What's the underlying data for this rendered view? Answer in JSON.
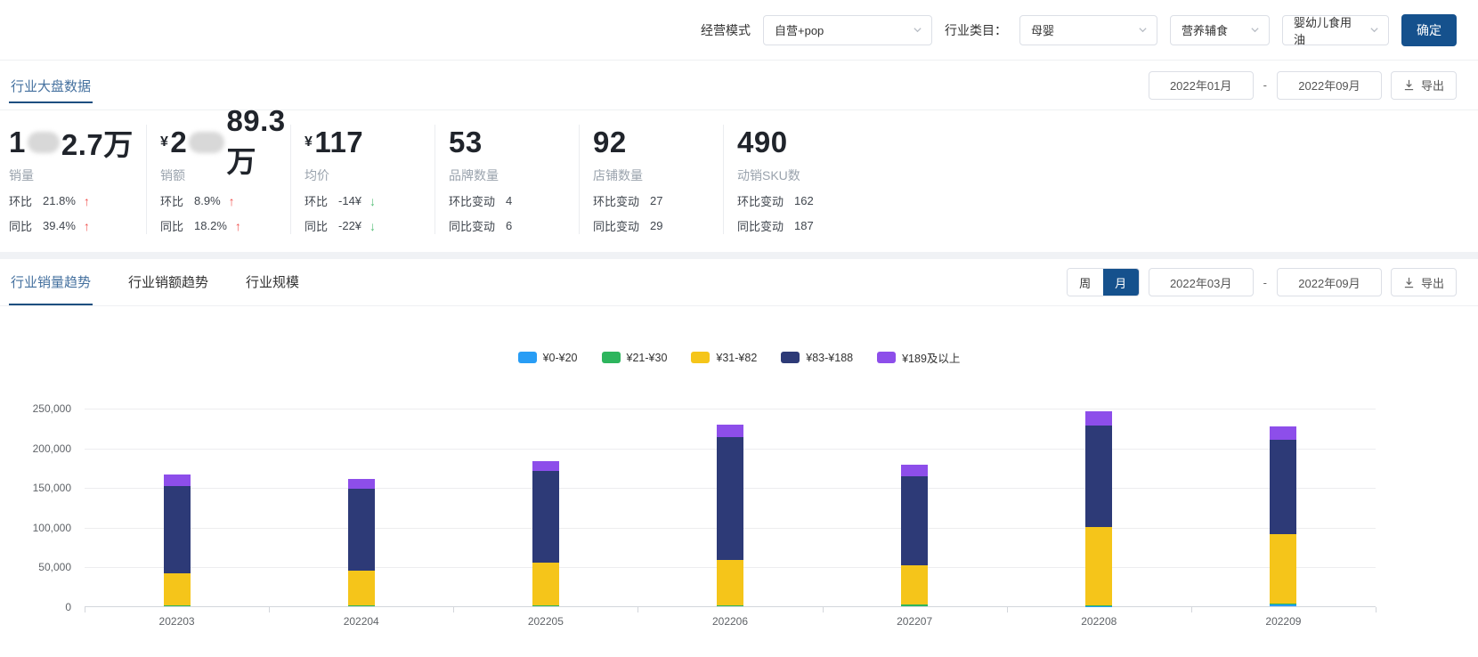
{
  "filter_bar": {
    "mode_label": "经营模式",
    "mode_value": "自营+pop",
    "category_label": "行业类目：",
    "category_value": "母婴",
    "subcategory_value": "营养辅食",
    "leaf_category_value": "婴幼儿食用油",
    "confirm_label": "确定"
  },
  "overview": {
    "title": "行业大盘数据",
    "date_start": "2022年01月",
    "date_sep": "-",
    "date_end": "2022年09月",
    "export_label": "导出",
    "cards": [
      {
        "big": {
          "prefix": "1",
          "masked": true,
          "suffix": "2.7万"
        },
        "label": "销量",
        "rows": [
          {
            "k": "环比",
            "v": "21.8%",
            "arrow": "↑"
          },
          {
            "k": "同比",
            "v": "39.4%",
            "arrow": "↑"
          }
        ]
      },
      {
        "big": {
          "currency": "¥",
          "prefix": "2",
          "masked": true,
          "suffix": "89.3万"
        },
        "label": "销额",
        "rows": [
          {
            "k": "环比",
            "v": "8.9%",
            "arrow": "↑"
          },
          {
            "k": "同比",
            "v": "18.2%",
            "arrow": "↑"
          }
        ]
      },
      {
        "big": {
          "currency": "¥",
          "prefix": "117"
        },
        "label": "均价",
        "rows": [
          {
            "k": "环比",
            "v": "-14¥",
            "arrow": "↓"
          },
          {
            "k": "同比",
            "v": "-22¥",
            "arrow": "↓"
          }
        ]
      },
      {
        "big": {
          "prefix": "53"
        },
        "label": "品牌数量",
        "rows": [
          {
            "k": "环比变动",
            "v": "4"
          },
          {
            "k": "同比变动",
            "v": "6"
          }
        ]
      },
      {
        "big": {
          "prefix": "92"
        },
        "label": "店铺数量",
        "rows": [
          {
            "k": "环比变动",
            "v": "27"
          },
          {
            "k": "同比变动",
            "v": "29"
          }
        ]
      },
      {
        "big": {
          "prefix": "490"
        },
        "label": "动销SKU数",
        "rows": [
          {
            "k": "环比变动",
            "v": "162"
          },
          {
            "k": "同比变动",
            "v": "187"
          }
        ]
      }
    ]
  },
  "trend": {
    "tabs": [
      {
        "label": "行业销量趋势",
        "active": true
      },
      {
        "label": "行业销额趋势",
        "active": false
      },
      {
        "label": "行业规模",
        "active": false
      }
    ],
    "period_week": "周",
    "period_month": "月",
    "period_active": "月",
    "date_start": "2022年03月",
    "date_sep": "-",
    "date_end": "2022年09月",
    "export_label": "导出"
  },
  "chart_data": {
    "type": "bar",
    "stacked": true,
    "categories": [
      "202203",
      "202204",
      "202205",
      "202206",
      "202207",
      "202208",
      "202209"
    ],
    "series": [
      {
        "name": "¥0-¥20",
        "color": "#289df5",
        "values": [
          0,
          0,
          0,
          0,
          0,
          500,
          2000
        ]
      },
      {
        "name": "¥21-¥30",
        "color": "#2db55d",
        "values": [
          1500,
          1000,
          1000,
          1000,
          2000,
          1000,
          1000
        ]
      },
      {
        "name": "¥31-¥82",
        "color": "#f5c51a",
        "values": [
          40000,
          44000,
          54000,
          57000,
          50000,
          98000,
          88000
        ]
      },
      {
        "name": "¥83-¥188",
        "color": "#2d3a77",
        "values": [
          110000,
          103000,
          115000,
          155000,
          112000,
          128000,
          119000
        ]
      },
      {
        "name": "¥189及以上",
        "color": "#8d4eea",
        "values": [
          14000,
          12000,
          13000,
          16000,
          14000,
          18000,
          16000
        ]
      }
    ],
    "title": "",
    "xlabel": "",
    "ylabel": "",
    "ylim": [
      0,
      250000
    ],
    "ytick_interval": 50000,
    "yticks": [
      "250,000",
      "200,000",
      "150,000",
      "100,000",
      "50,000",
      "0"
    ],
    "grid": true,
    "legend_position": "top"
  }
}
